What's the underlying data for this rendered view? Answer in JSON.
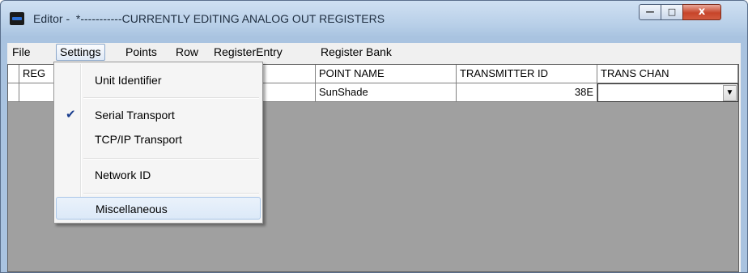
{
  "window": {
    "title": "Editor -  *-----------CURRENTLY EDITING ANALOG OUT REGISTERS",
    "controls": {
      "minimize": "—",
      "maximize": "□",
      "close": "x"
    }
  },
  "menubar": {
    "items": [
      {
        "label": "File"
      },
      {
        "label": "Settings"
      },
      {
        "label": "Points"
      },
      {
        "label": "Row"
      },
      {
        "label": "RegisterEntry"
      },
      {
        "label": "Register Bank"
      }
    ]
  },
  "grid": {
    "headers": [
      "REG",
      "",
      "POINT NAME",
      "TRANSMITTER ID",
      "TRANS CHAN"
    ],
    "rows": [
      {
        "reg": "",
        "col2": "",
        "point_name": "SunShade",
        "transmitter_id": "38E",
        "trans_chan": ""
      }
    ]
  },
  "settings_menu": {
    "items": [
      {
        "label": "Unit Identifier",
        "checked": false
      },
      {
        "label": "Serial Transport",
        "checked": true,
        "check_glyph": "✔"
      },
      {
        "label": "TCP/IP Transport",
        "checked": false
      },
      {
        "label": "Network ID",
        "checked": false
      },
      {
        "label": "Miscellaneous",
        "checked": false,
        "highlighted": true
      }
    ]
  },
  "combo": {
    "arrow": "▼"
  },
  "colors": {
    "title_bar": "#b8cfe8",
    "grid_background": "#a0a0a0",
    "close_button": "#c7452a",
    "menu_highlight": "#dce9f8"
  }
}
